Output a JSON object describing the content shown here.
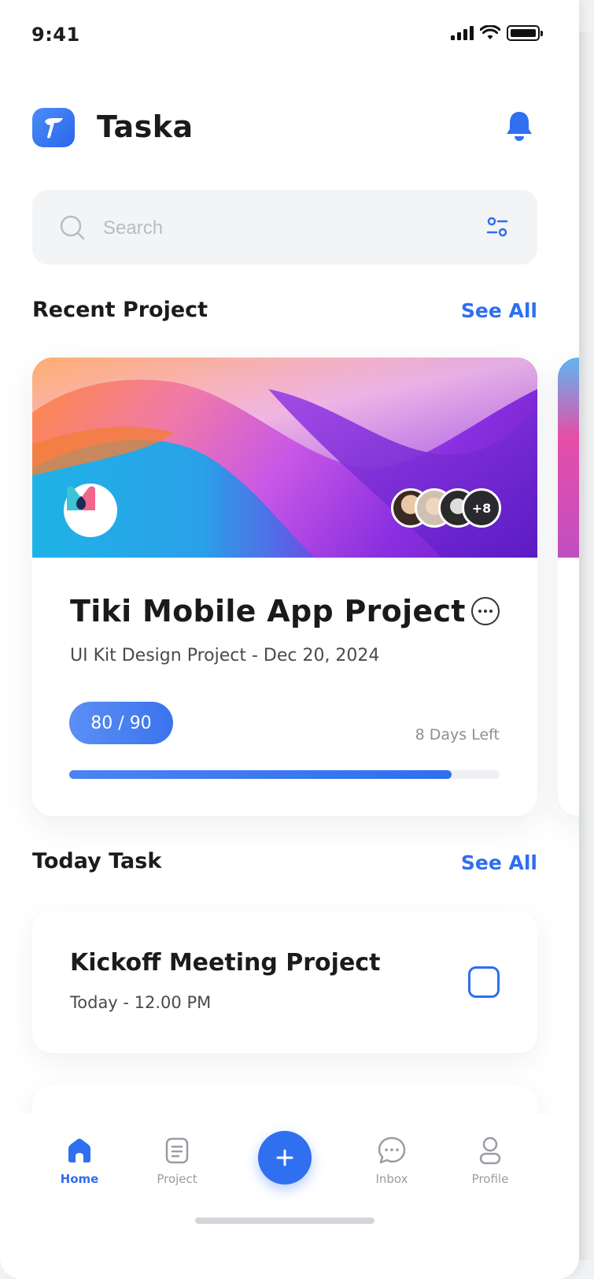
{
  "status_bar": {
    "time": "9:41"
  },
  "header": {
    "app_name": "Taska"
  },
  "search": {
    "placeholder": "Search"
  },
  "recent_project": {
    "section_title": "Recent Project",
    "see_all_label": "See All",
    "project": {
      "title": "Tiki Mobile App Project",
      "subtitle": "UI Kit Design Project - Dec 20, 2024",
      "progress_label": "80 / 90",
      "progress_fraction": 0.8889,
      "days_left": "8 Days Left",
      "extra_members": "+8"
    }
  },
  "today_task": {
    "section_title": "Today Task",
    "see_all_label": "See All",
    "tasks": [
      {
        "title": "Kickoff Meeting Project",
        "time": "Today - 12.00 PM",
        "checked": false
      }
    ]
  },
  "bottom_nav": {
    "items": [
      {
        "label": "Home",
        "icon": "home-icon",
        "active": true
      },
      {
        "label": "Project",
        "icon": "document-icon",
        "active": false
      },
      {
        "label": "Inbox",
        "icon": "chat-icon",
        "active": false
      },
      {
        "label": "Profile",
        "icon": "user-icon",
        "active": false
      }
    ]
  },
  "colors": {
    "accent": "#2f6ff0",
    "text_primary": "#1b1b1d",
    "text_secondary": "#4a4a50",
    "muted": "#9a9ca3",
    "search_bg": "#f3f4f6"
  }
}
